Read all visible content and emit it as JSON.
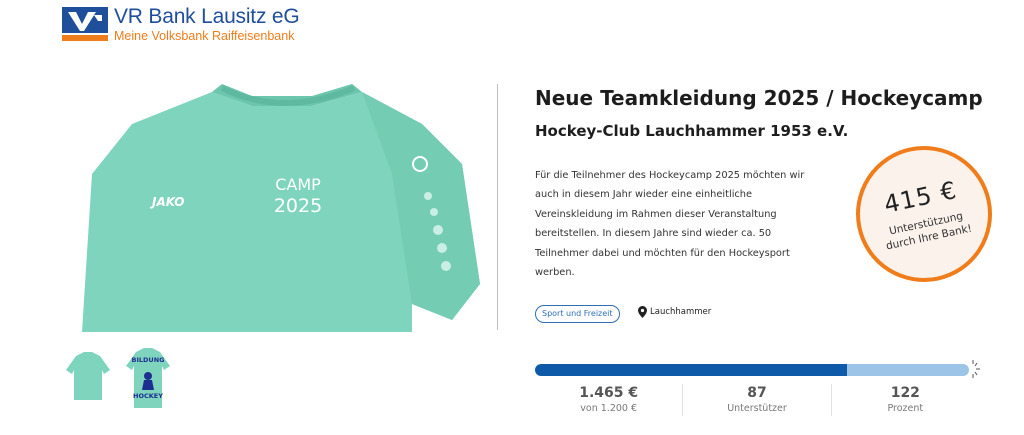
{
  "header": {
    "bank_name": "VR Bank Lausitz eG",
    "bank_slogan": "Meine Volksbank Raiffeisenbank"
  },
  "project": {
    "title": "Neue Teamkleidung 2025 / Hockeycamp",
    "organization": "Hockey-Club Lauchhammer 1953 e.V.",
    "description": "Für die Teilnehmer des Hockeycamp 2025 möchten wir auch in diesem Jahr wieder eine einheitliche Vereinskleidung im Rahmen dieser Veranstaltung bereitstellen. In diesem Jahre sind wieder ca. 50 Teilnehmer dabei und möchten für den Hockeysport werben.",
    "category_tag": "Sport und Freizeit",
    "location": "Lauchhammer"
  },
  "image": {
    "shirt_brand": "JAKO",
    "print_line1": "CAMP",
    "print_line2": "2025",
    "thumb2_text_top": "BILDUNG",
    "thumb2_text_bottom": "HOCKEY"
  },
  "badge": {
    "amount": "415 €",
    "line1": "Unterstützung",
    "line2": "durch Ihre Bank!"
  },
  "progress": {
    "fraction": 0.72
  },
  "stats": {
    "raised_value": "1.465 €",
    "raised_label": "von 1.200 €",
    "supporters_value": "87",
    "supporters_label": "Unterstützer",
    "percent_value": "122",
    "percent_label": "Prozent"
  },
  "colors": {
    "brand_blue": "#1f4e9a",
    "brand_orange": "#f07d1b",
    "shirt_mint": "#7fd4bd",
    "progress_fill": "#0f5aa8",
    "progress_track": "#9cc4e6"
  }
}
